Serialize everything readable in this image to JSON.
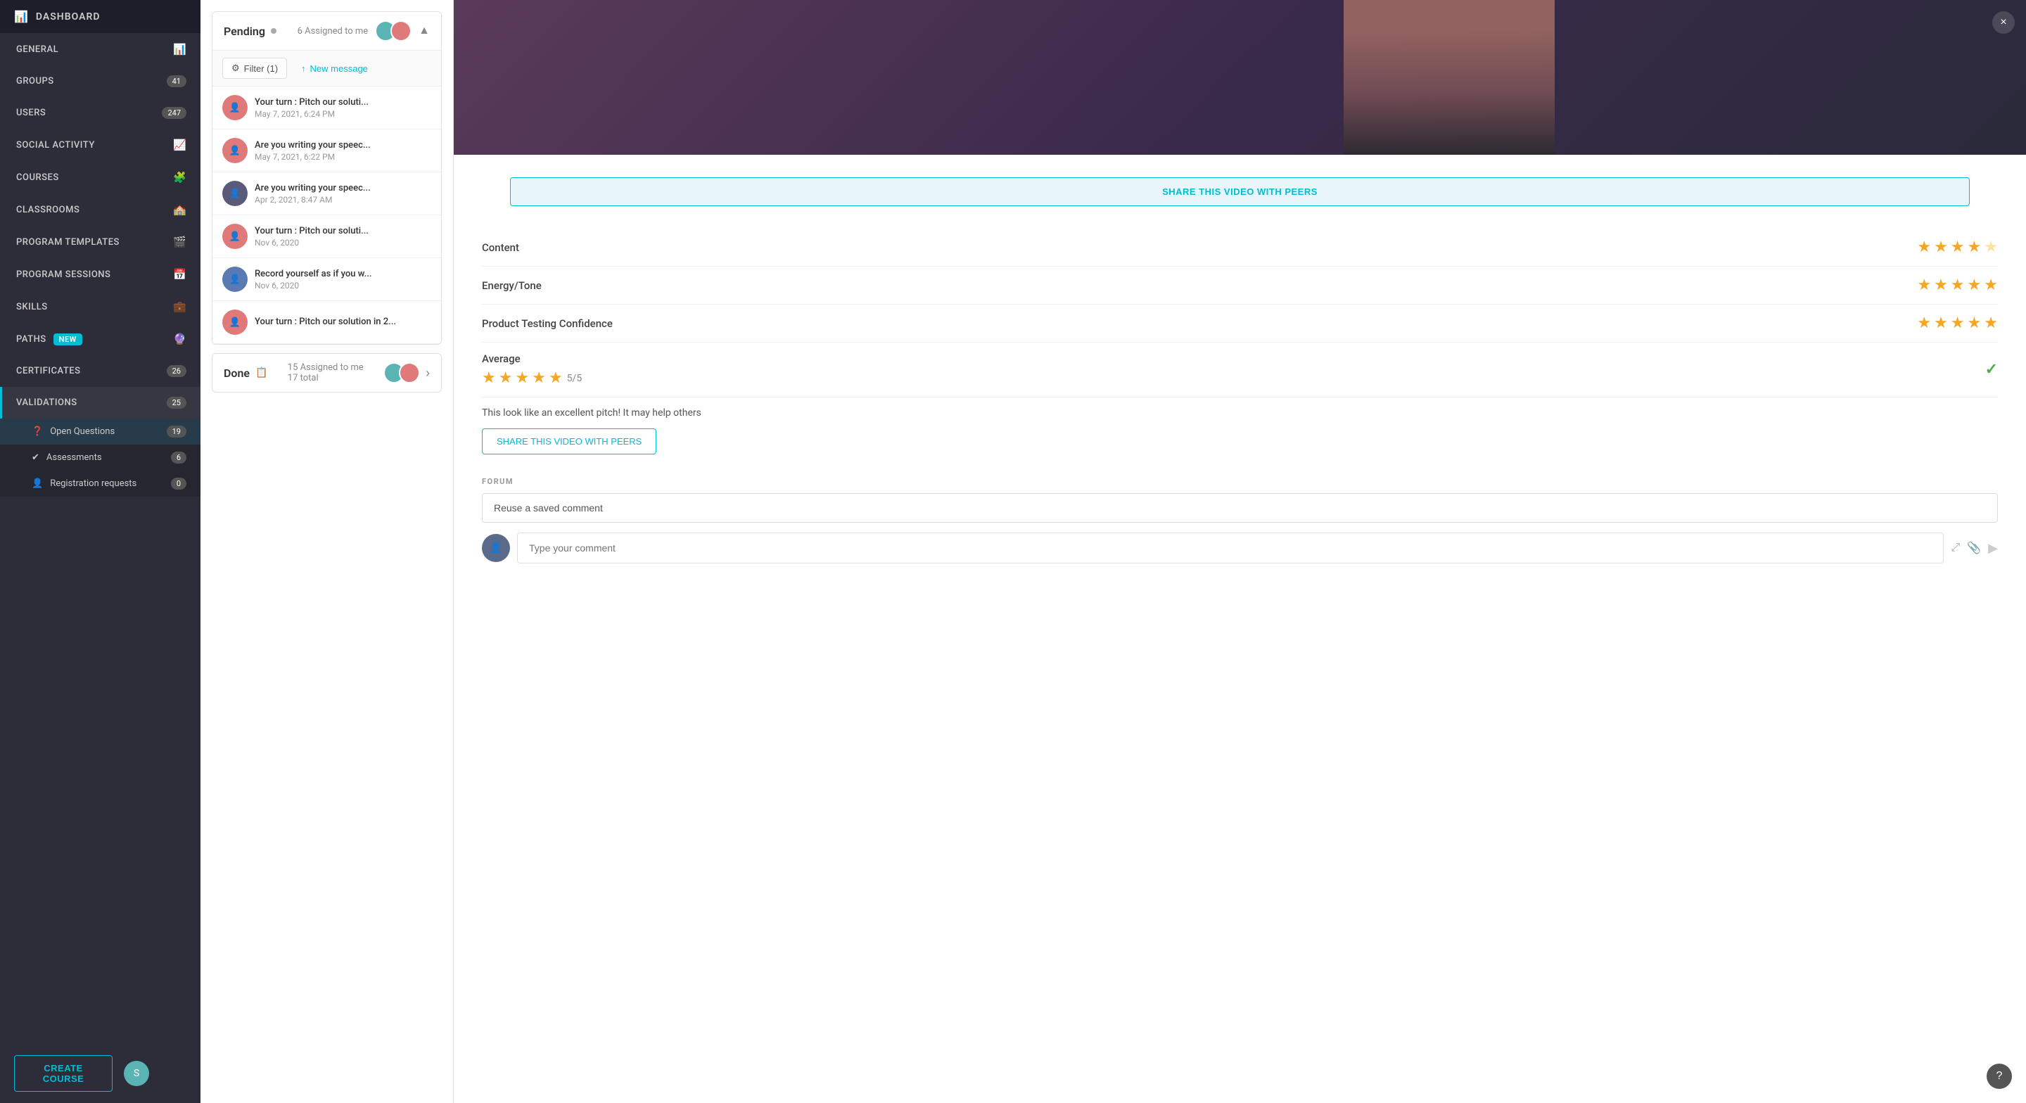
{
  "app": {
    "title": "DASHBOARD"
  },
  "sidebar": {
    "nav_items": [
      {
        "id": "general",
        "label": "GENERAL",
        "badge": "",
        "icon": "📊",
        "active": false
      },
      {
        "id": "groups",
        "label": "GROUPS",
        "badge": "41",
        "icon": "👥",
        "active": false
      },
      {
        "id": "users",
        "label": "USERS",
        "badge": "247",
        "icon": "👤",
        "active": false
      },
      {
        "id": "social",
        "label": "SOCIAL ACTIVITY",
        "badge": "",
        "icon": "📈",
        "active": false
      },
      {
        "id": "courses",
        "label": "COURSES",
        "badge": "",
        "icon": "🧩",
        "active": false
      },
      {
        "id": "classrooms",
        "label": "CLASSROOMS",
        "badge": "",
        "icon": "🏫",
        "active": false
      },
      {
        "id": "program-templates",
        "label": "PROGRAM TEMPLATES",
        "badge": "",
        "icon": "🎬",
        "active": false
      },
      {
        "id": "program-sessions",
        "label": "PROGRAM SESSIONS",
        "badge": "",
        "icon": "📅",
        "active": false
      },
      {
        "id": "skills",
        "label": "SKILLS",
        "badge": "",
        "icon": "💼",
        "active": false
      },
      {
        "id": "paths",
        "label": "PATHS",
        "badge": "NEW",
        "icon": "🔮",
        "is_new": true,
        "active": false
      },
      {
        "id": "certificates",
        "label": "CERTIFICATES",
        "badge": "26",
        "icon": "",
        "active": false
      },
      {
        "id": "validations",
        "label": "VALIDATIONS",
        "badge": "25",
        "icon": "",
        "active": true
      }
    ],
    "sub_items": [
      {
        "id": "open-questions",
        "label": "Open Questions",
        "badge": "19",
        "icon": "❓",
        "active": true
      },
      {
        "id": "assessments",
        "label": "Assessments",
        "badge": "6",
        "icon": "✔",
        "active": false
      },
      {
        "id": "registration",
        "label": "Registration requests",
        "badge": "0",
        "icon": "👤",
        "active": false
      }
    ],
    "create_course_label": "CREATE COURSE"
  },
  "pending": {
    "title": "Pending",
    "assigned_label": "6 Assigned to me",
    "filter_label": "Filter (1)",
    "new_message_label": "New message",
    "messages": [
      {
        "id": 1,
        "title": "Your turn : Pitch our soluti...",
        "date": "May 7, 2021, 6:24 PM",
        "avatar_color": "av-pink"
      },
      {
        "id": 2,
        "title": "Are you writing your speec...",
        "date": "May 7, 2021, 6:22 PM",
        "avatar_color": "av-pink"
      },
      {
        "id": 3,
        "title": "Are you writing your speec...",
        "date": "Apr 2, 2021, 8:47 AM",
        "avatar_color": "av-dark"
      },
      {
        "id": 4,
        "title": "Your turn : Pitch our soluti...",
        "date": "Nov 6, 2020",
        "avatar_color": "av-pink"
      },
      {
        "id": 5,
        "title": "Record yourself as if you w...",
        "date": "Nov 6, 2020",
        "avatar_color": "av-blue"
      },
      {
        "id": 6,
        "title": "Your turn : Pitch our solution in 2...",
        "date": "",
        "avatar_color": "av-pink"
      }
    ]
  },
  "done": {
    "title": "Done",
    "assigned_label": "15 Assigned to me",
    "total_label": "17 total"
  },
  "video": {
    "share_with_peers_label": "SHARE THIS VIDEO WITH PEERS",
    "share_with_peers_label2": "SHARE THIS VIDEO WITH PEERS"
  },
  "ratings": [
    {
      "id": "content",
      "label": "Content",
      "stars": 4.5,
      "filled": 4,
      "half": false,
      "total": 5
    },
    {
      "id": "energy",
      "label": "Energy/Tone",
      "stars": 5,
      "filled": 5,
      "half": false,
      "total": 5
    },
    {
      "id": "confidence",
      "label": "Product Testing Confidence",
      "stars": 5,
      "filled": 5,
      "half": false,
      "total": 5
    }
  ],
  "average": {
    "label": "Average",
    "score": "5",
    "out_of": "/5",
    "note": "This look like an excellent pitch! It may help others"
  },
  "forum": {
    "label": "FORUM",
    "saved_comment_placeholder": "Reuse a saved comment",
    "comment_placeholder": "Type your comment",
    "share_btn_label": "SHARE THIS VIDEO WITH PEERS"
  },
  "close_label": "×"
}
